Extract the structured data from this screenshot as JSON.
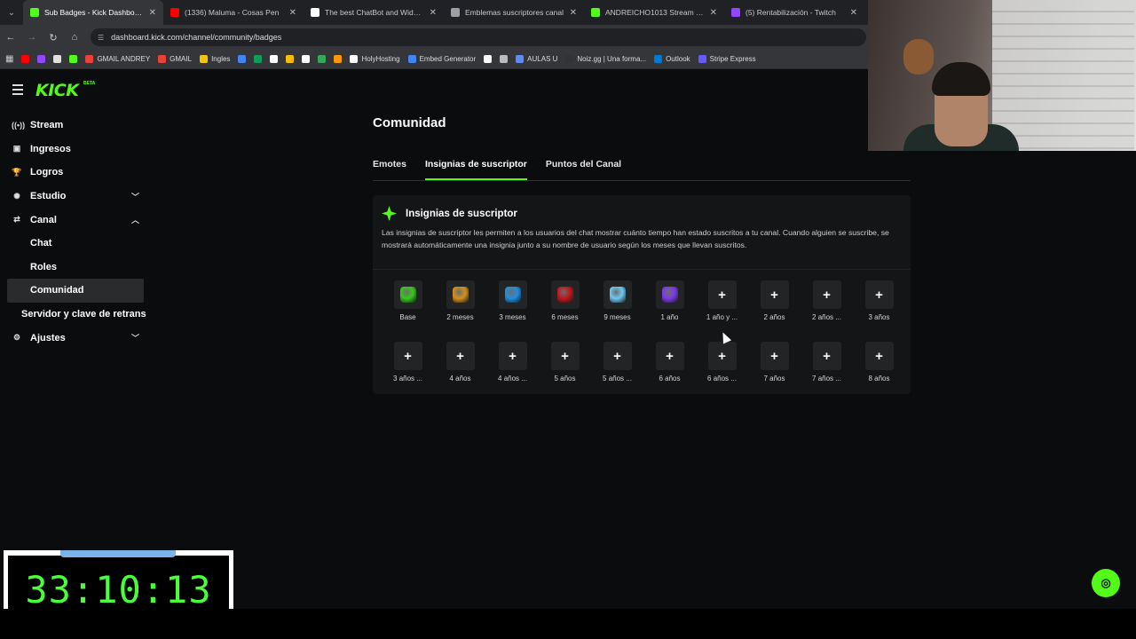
{
  "browser": {
    "tabs": [
      {
        "title": "Sub Badges - Kick Dashboard",
        "color": "#53fc18",
        "active": true
      },
      {
        "title": "(1336) Maluma - Cosas Pen",
        "color": "#ff0000",
        "active": false
      },
      {
        "title": "The best ChatBot and Widgets",
        "color": "#ffffff",
        "active": false
      },
      {
        "title": "Emblemas suscriptores canal",
        "color": "#9aa0a6",
        "active": false
      },
      {
        "title": "ANDREICHO1013 Stream - Wa",
        "color": "#53fc18",
        "active": false
      },
      {
        "title": "(5) Rentabilización - Twitch",
        "color": "#9146ff",
        "active": false
      }
    ],
    "url": "dashboard.kick.com/channel/community/badges",
    "bookmarks": [
      {
        "label": "",
        "color": "#ff0000"
      },
      {
        "label": "",
        "color": "#9146ff"
      },
      {
        "label": "",
        "color": "#e0e0e0"
      },
      {
        "label": "",
        "color": "#53fc18"
      },
      {
        "label": "GMAIL ANDREY",
        "color": "#ea4335"
      },
      {
        "label": "GMAIL",
        "color": "#ea4335"
      },
      {
        "label": "Ingles",
        "color": "#f4c20d"
      },
      {
        "label": "",
        "color": "#4285f4"
      },
      {
        "label": "",
        "color": "#0f9d58"
      },
      {
        "label": "",
        "color": "#ffffff"
      },
      {
        "label": "",
        "color": "#fbbc05"
      },
      {
        "label": "",
        "color": "#ffffff"
      },
      {
        "label": "",
        "color": "#34a853"
      },
      {
        "label": "",
        "color": "#ff9800"
      },
      {
        "label": "HolyHosting",
        "color": "#ffffff"
      },
      {
        "label": "Embed Generator",
        "color": "#4285f4"
      },
      {
        "label": "",
        "color": "#ffffff"
      },
      {
        "label": "",
        "color": "#bbbbbb"
      },
      {
        "label": "AULAS U",
        "color": "#5a8dee"
      },
      {
        "label": "Noiz.gg | Una forma...",
        "color": "#333333"
      },
      {
        "label": "Outlook",
        "color": "#0078d4"
      },
      {
        "label": "Stripe Express",
        "color": "#635bff"
      }
    ]
  },
  "sidebar": {
    "items": [
      {
        "label": "Stream",
        "icon": "broadcast-icon",
        "glyph": "((•))",
        "chevron": ""
      },
      {
        "label": "Ingresos",
        "icon": "revenue-icon",
        "glyph": "▣",
        "chevron": ""
      },
      {
        "label": "Logros",
        "icon": "trophy-icon",
        "glyph": "🏆",
        "chevron": ""
      },
      {
        "label": "Estudio",
        "icon": "studio-icon",
        "glyph": "✺",
        "chevron": "﹀"
      },
      {
        "label": "Canal",
        "icon": "channel-icon",
        "glyph": "⇄",
        "chevron": "︿"
      }
    ],
    "sub_items": [
      "Chat",
      "Roles",
      "Comunidad"
    ],
    "active_sub": "Comunidad",
    "plain_item": "Servidor y clave de retrans",
    "settings": {
      "label": "Ajustes",
      "glyph": "⚙",
      "chevron": "﹀"
    }
  },
  "main": {
    "title": "Comunidad",
    "tabs": [
      "Emotes",
      "Insignias de suscriptor",
      "Puntos del Canal"
    ],
    "active_tab": "Insignias de suscriptor",
    "card": {
      "title": "Insignias de suscriptor",
      "description": "Las insignias de suscriptor les permiten a los usuarios del chat mostrar cuánto tiempo han estado suscritos a tu canal. Cuando alguien se suscribe, se mostrará automáticamente una insignia junto a su nombre de usuario según los meses que llevan suscritos."
    },
    "badge_rows": [
      [
        {
          "label": "Base",
          "gem": "#36c91b"
        },
        {
          "label": "2 meses",
          "gem": "#d4901a"
        },
        {
          "label": "3 meses",
          "gem": "#1f8fe0"
        },
        {
          "label": "6 meses",
          "gem": "#c0161e"
        },
        {
          "label": "9 meses",
          "gem": "#6cc8f0"
        },
        {
          "label": "1 año",
          "gem": "#7c3ae8"
        },
        {
          "label": "1 año y ...",
          "gem": ""
        },
        {
          "label": "2 años",
          "gem": ""
        },
        {
          "label": "2 años ...",
          "gem": ""
        },
        {
          "label": "3 años",
          "gem": ""
        }
      ],
      [
        {
          "label": "3 años ...",
          "gem": ""
        },
        {
          "label": "4 años",
          "gem": ""
        },
        {
          "label": "4 años ...",
          "gem": ""
        },
        {
          "label": "5 años",
          "gem": ""
        },
        {
          "label": "5 años ...",
          "gem": ""
        },
        {
          "label": "6 años",
          "gem": ""
        },
        {
          "label": "6 años ...",
          "gem": ""
        },
        {
          "label": "7 años",
          "gem": ""
        },
        {
          "label": "7 años ...",
          "gem": ""
        },
        {
          "label": "8 años",
          "gem": ""
        }
      ]
    ],
    "add_glyph": "+"
  },
  "timer": {
    "value": "33:10:13"
  },
  "accent": "#53fc18"
}
